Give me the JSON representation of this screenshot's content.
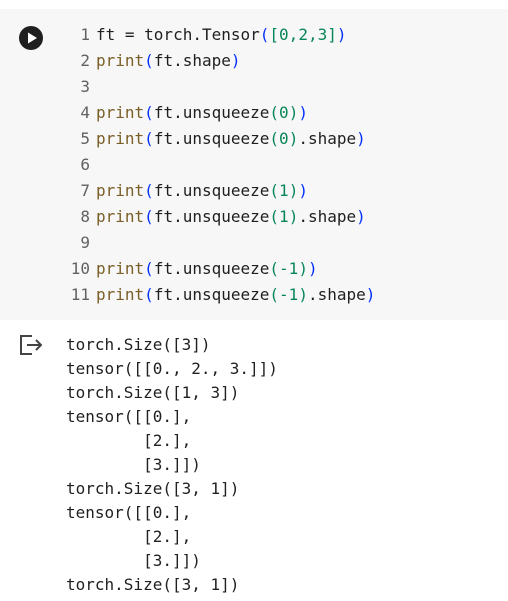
{
  "code_cell": {
    "run_icon": "play-circle-icon",
    "lines": [
      {
        "n": "1",
        "tokens": [
          {
            "t": "ft = torch.Tensor",
            "c": "plain"
          },
          {
            "t": "(",
            "c": "punc"
          },
          {
            "t": "[",
            "c": "num"
          },
          {
            "t": "0,2,3",
            "c": "num"
          },
          {
            "t": "]",
            "c": "num"
          },
          {
            "t": ")",
            "c": "punc"
          }
        ]
      },
      {
        "n": "2",
        "tokens": [
          {
            "t": "print",
            "c": "kw"
          },
          {
            "t": "(",
            "c": "punc"
          },
          {
            "t": "ft.shape",
            "c": "plain"
          },
          {
            "t": ")",
            "c": "punc"
          }
        ]
      },
      {
        "n": "3",
        "tokens": []
      },
      {
        "n": "4",
        "tokens": [
          {
            "t": "print",
            "c": "kw"
          },
          {
            "t": "(",
            "c": "punc"
          },
          {
            "t": "ft.unsqueeze",
            "c": "plain"
          },
          {
            "t": "(",
            "c": "num"
          },
          {
            "t": "0",
            "c": "num"
          },
          {
            "t": ")",
            "c": "num"
          },
          {
            "t": ")",
            "c": "punc"
          }
        ]
      },
      {
        "n": "5",
        "tokens": [
          {
            "t": "print",
            "c": "kw"
          },
          {
            "t": "(",
            "c": "punc"
          },
          {
            "t": "ft.unsqueeze",
            "c": "plain"
          },
          {
            "t": "(",
            "c": "num"
          },
          {
            "t": "0",
            "c": "num"
          },
          {
            "t": ")",
            "c": "num"
          },
          {
            "t": ".shape",
            "c": "plain"
          },
          {
            "t": ")",
            "c": "punc"
          }
        ]
      },
      {
        "n": "6",
        "tokens": []
      },
      {
        "n": "7",
        "tokens": [
          {
            "t": "print",
            "c": "kw"
          },
          {
            "t": "(",
            "c": "punc"
          },
          {
            "t": "ft.unsqueeze",
            "c": "plain"
          },
          {
            "t": "(",
            "c": "num"
          },
          {
            "t": "1",
            "c": "num"
          },
          {
            "t": ")",
            "c": "num"
          },
          {
            "t": ")",
            "c": "punc"
          }
        ]
      },
      {
        "n": "8",
        "tokens": [
          {
            "t": "print",
            "c": "kw"
          },
          {
            "t": "(",
            "c": "punc"
          },
          {
            "t": "ft.unsqueeze",
            "c": "plain"
          },
          {
            "t": "(",
            "c": "num"
          },
          {
            "t": "1",
            "c": "num"
          },
          {
            "t": ")",
            "c": "num"
          },
          {
            "t": ".shape",
            "c": "plain"
          },
          {
            "t": ")",
            "c": "punc"
          }
        ]
      },
      {
        "n": "9",
        "tokens": []
      },
      {
        "n": "10",
        "tokens": [
          {
            "t": "print",
            "c": "kw"
          },
          {
            "t": "(",
            "c": "punc"
          },
          {
            "t": "ft.unsqueeze",
            "c": "plain"
          },
          {
            "t": "(",
            "c": "num"
          },
          {
            "t": "-1",
            "c": "num"
          },
          {
            "t": ")",
            "c": "num"
          },
          {
            "t": ")",
            "c": "punc"
          }
        ]
      },
      {
        "n": "11",
        "tokens": [
          {
            "t": "print",
            "c": "kw"
          },
          {
            "t": "(",
            "c": "punc"
          },
          {
            "t": "ft.unsqueeze",
            "c": "plain"
          },
          {
            "t": "(",
            "c": "num"
          },
          {
            "t": "-1",
            "c": "num"
          },
          {
            "t": ")",
            "c": "num"
          },
          {
            "t": ".shape",
            "c": "plain"
          },
          {
            "t": ")",
            "c": "punc"
          }
        ]
      }
    ]
  },
  "output_cell": {
    "icon": "output-arrow-icon",
    "lines": [
      "torch.Size([3])",
      "tensor([[0., 2., 3.]])",
      "torch.Size([1, 3])",
      "tensor([[0.],",
      "        [2.],",
      "        [3.]])",
      "torch.Size([3, 1])",
      "tensor([[0.],",
      "        [2.],",
      "        [3.]])",
      "torch.Size([3, 1])"
    ]
  },
  "colors": {
    "cell_bg": "#f7f7f7",
    "keyword": "#795e26",
    "bracket": "#0431fa",
    "number": "#098658",
    "line_number": "#616161"
  }
}
